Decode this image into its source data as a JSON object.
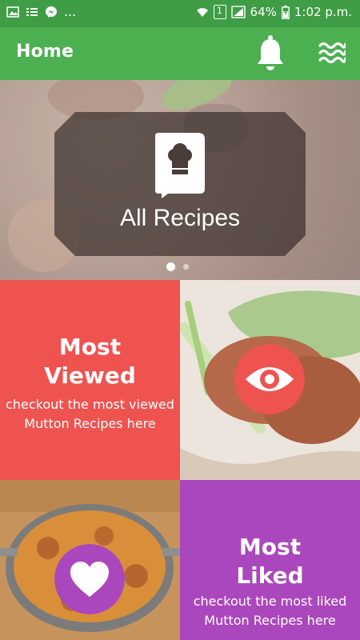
{
  "status_bar": {
    "battery": "64%",
    "time": "1:02 p.m.",
    "sim_label": "1",
    "left_ellipsis": "..."
  },
  "app_bar": {
    "title": "Home",
    "bell_icon": "bell-icon",
    "menu_icon": "waves-menu-icon",
    "color": "#4caf50"
  },
  "hero": {
    "label": "All Recipes",
    "icon": "recipe-book-icon",
    "slides_total": 2,
    "active_slide": 1
  },
  "tiles": {
    "most_viewed": {
      "title_line1": "Most",
      "title_line2": "Viewed",
      "subtitle_line1": "checkout the most viewed",
      "subtitle_line2": "Mutton Recipes here",
      "icon": "eye-icon",
      "color": "#ef5350"
    },
    "most_liked": {
      "title_line1": "Most",
      "title_line2": "Liked",
      "subtitle_line1": "checkout the most liked",
      "subtitle_line2": "Mutton Recipes here",
      "icon": "heart-icon",
      "color": "#ab47bc"
    }
  }
}
